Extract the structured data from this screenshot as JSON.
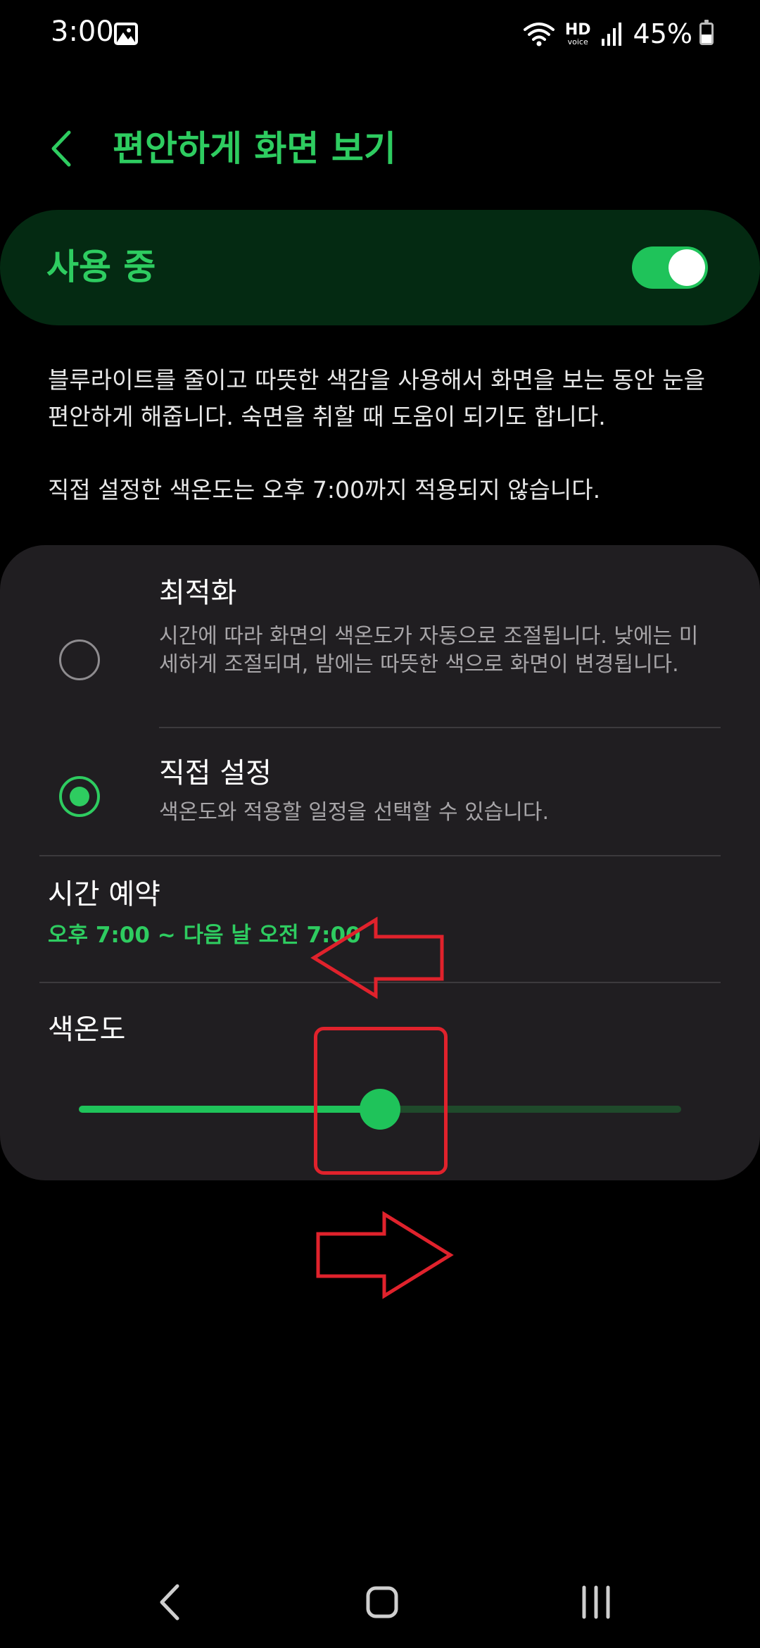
{
  "status_bar": {
    "time": "3:00",
    "hd_label": "HD",
    "voice_label": "voice",
    "battery": "45%"
  },
  "header": {
    "title": "편안하게 화면 보기"
  },
  "master_toggle": {
    "label": "사용 중",
    "on": true
  },
  "description": "블루라이트를 줄이고 따뜻한 색감을 사용해서 화면을 보는 동안 눈을 편안하게 해줍니다. 숙면을 취할 때 도움이 되기도 합니다.",
  "schedule_note": "직접 설정한 색온도는 오후 7:00까지 적용되지 않습니다.",
  "options": [
    {
      "title": "최적화",
      "description": "시간에 따라 화면의 색온도가 자동으로 조절됩니다. 낮에는 미세하게 조절되며, 밤에는 따뜻한 색으로 화면이 변경됩니다.",
      "selected": false
    },
    {
      "title": "직접 설정",
      "description": "색온도와 적용할 일정을 선택할 수 있습니다.",
      "selected": true
    }
  ],
  "schedule": {
    "title": "시간 예약",
    "value": "오후 7:00 ~ 다음 날 오전 7:00"
  },
  "color_temperature": {
    "title": "색온도",
    "level": 0.5
  },
  "colors": {
    "accent": "#2ecc60",
    "annotation": "#e0222c",
    "card": "#201e21",
    "master_card": "#042a12"
  }
}
